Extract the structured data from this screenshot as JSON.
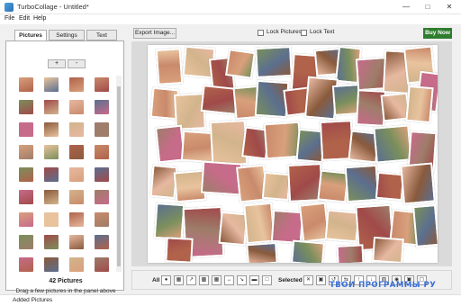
{
  "window": {
    "title": "TurboCollage - Untitled*"
  },
  "menu": {
    "file": "File",
    "edit": "Edit",
    "help": "Help"
  },
  "tabs": {
    "pictures": "Pictures",
    "settings": "Settings",
    "text": "Text"
  },
  "panel": {
    "add_label": "+",
    "remove_label": "-",
    "count": "42 Pictures",
    "hint": "Drag a few pictures in the panel above"
  },
  "toolbar": {
    "export_label": "Export Image...",
    "lock_pictures": "Lock Pictures",
    "lock_text": "Lock Text",
    "buy_now": "Buy Now"
  },
  "bottombar": {
    "all_label": "All",
    "selected_label": "Selected"
  },
  "watermark": "ТВОИ ПРОГРАММЫ РУ",
  "status": "Added Pictures",
  "colors": {
    "buy_now": "#2f7d2f",
    "watermark": "#3a6fd8"
  }
}
